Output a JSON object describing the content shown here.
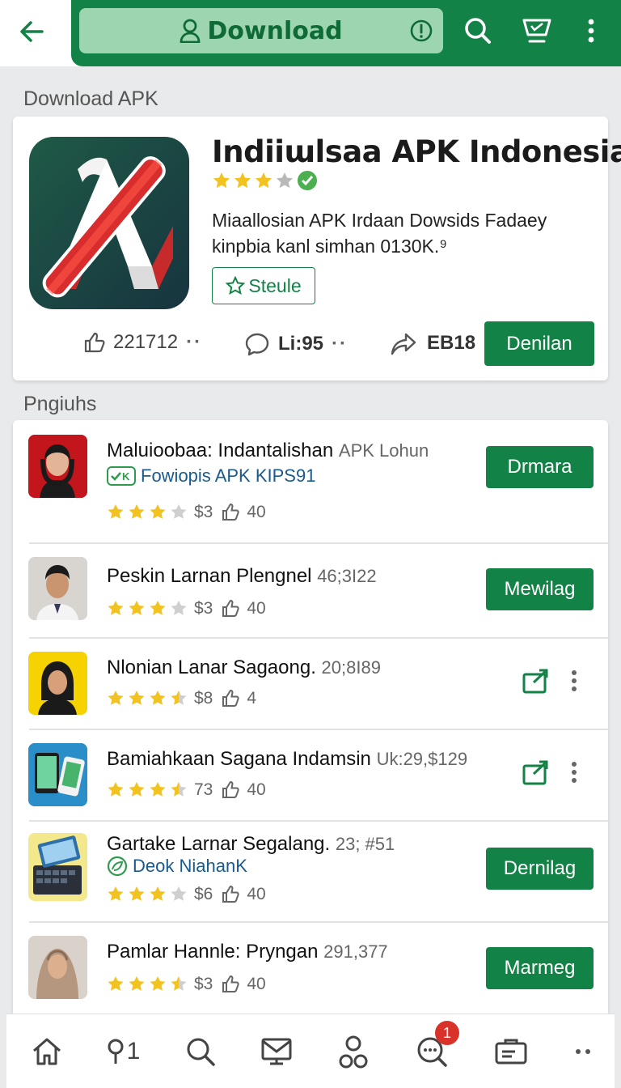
{
  "header": {
    "search_label": "Download",
    "icons": [
      "back-arrow-icon",
      "user-icon",
      "info-icon",
      "search-icon",
      "cart-icon",
      "more-vertical-icon"
    ]
  },
  "sections": {
    "featured_title": "Download APK",
    "list_title": "Pngiuhs"
  },
  "featured": {
    "name": "Indiiɯlsaa APK Indonesia",
    "rating_stars": 3.5,
    "description": "Miaallosian APK Irdaan Dowsids Fadaey kinpbia kanl simhan 0130K.⁹",
    "status_chip": "Steule",
    "stats": {
      "likes": "221712",
      "comments": "Li:95",
      "shares": "EB18"
    },
    "button": "Denilan"
  },
  "list": [
    {
      "title": "Maluioobaa: Indantalishan",
      "extra": "APK Lohun",
      "sub": "Fowiopis APK KIPS91",
      "rating": 3,
      "price": "$3",
      "count": "40",
      "action": "button",
      "button": "Drmara"
    },
    {
      "title": "Peskin Larnan Plengnel",
      "extra": "46;3I22",
      "rating": 3,
      "price": "$3",
      "count": "40",
      "action": "button",
      "button": "Mewilag"
    },
    {
      "title": "Nlonian Lanar Sagaong.",
      "extra": "20;8I89",
      "rating": 3.5,
      "price": "$8",
      "count": "4",
      "action": "icons"
    },
    {
      "title": "Bamiahkaan Sagana Indamsin",
      "extra": "Uk:29,$129",
      "rating": 3.5,
      "price": "73",
      "count": "40",
      "action": "icons"
    },
    {
      "title": "Gartake Larnar Segalang.",
      "extra": "23; #51",
      "sub": "Deok NiahanK",
      "rating": 3,
      "price": "$6",
      "count": "40",
      "action": "button",
      "button": "Dernilag"
    },
    {
      "title": "Pamlar Hannle: Pryngan",
      "extra": "291,377",
      "rating": 3.5,
      "price": "$3",
      "count": "40",
      "action": "button",
      "button": "Marmeg"
    }
  ],
  "bottom_nav": {
    "items": [
      "home-icon",
      "location-icon",
      "search-icon",
      "inbox-icon",
      "people-icon",
      "chat-icon",
      "card-icon",
      "more-icon"
    ],
    "location_label": "1",
    "badge": "1"
  },
  "colors": {
    "primary_green": "#138246",
    "pill_green": "#9dd5b1",
    "star": "#f2c320",
    "badge_red": "#d9322b"
  }
}
